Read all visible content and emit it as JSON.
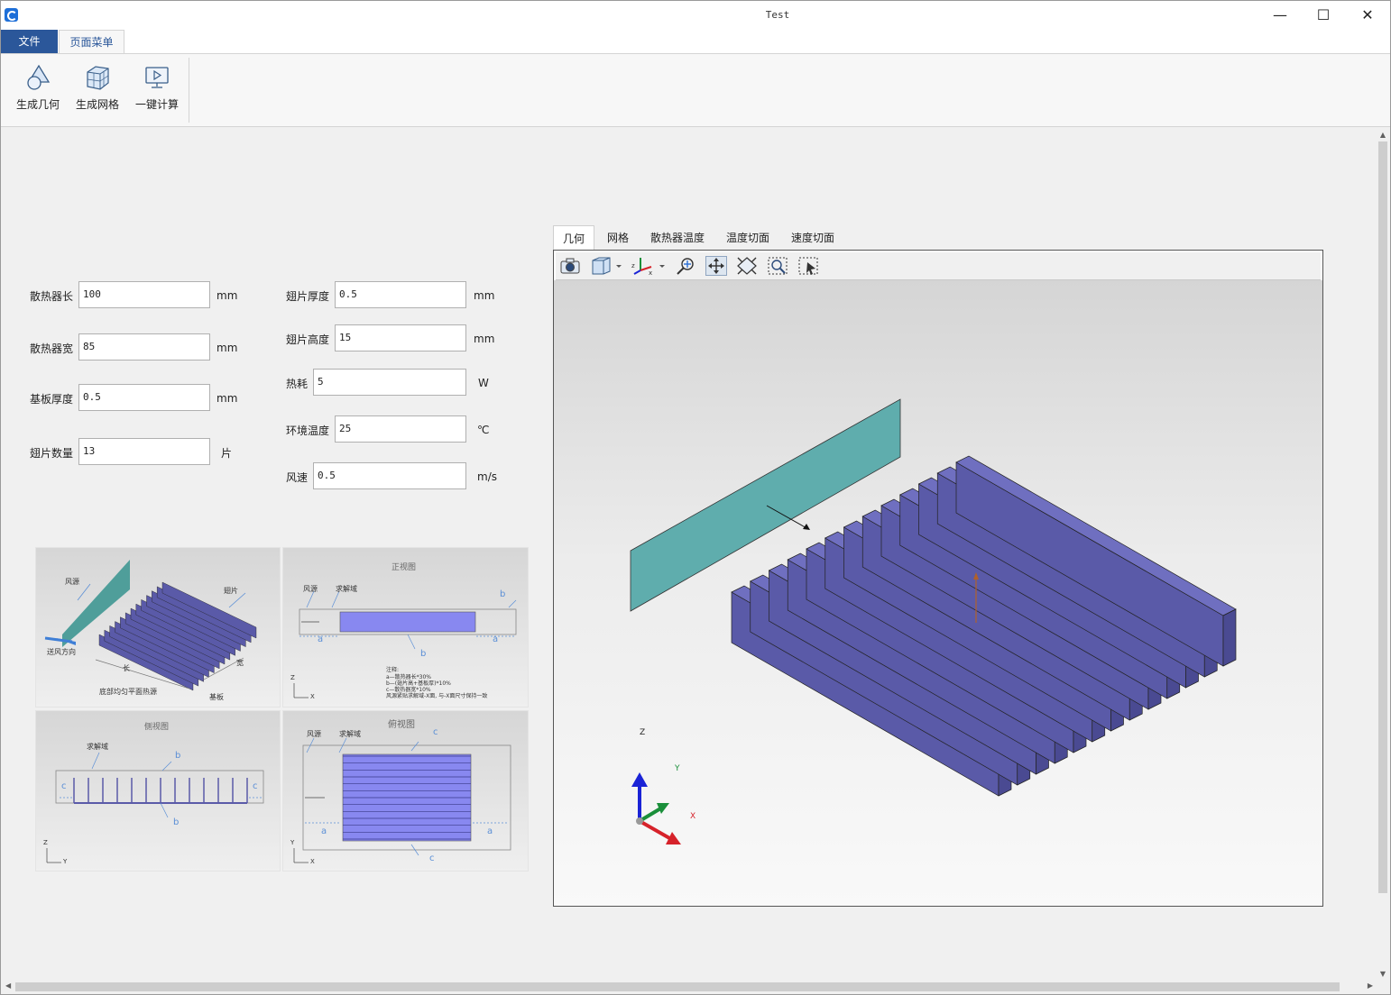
{
  "window": {
    "title": "Test"
  },
  "ribbon": {
    "tabs": [
      "文件",
      "页面菜单"
    ],
    "buttons": [
      {
        "label": "生成几何",
        "icon": "geometry-shapes-icon"
      },
      {
        "label": "生成网格",
        "icon": "mesh-cube-icon"
      },
      {
        "label": "一键计算",
        "icon": "compute-monitor-icon"
      }
    ]
  },
  "params": {
    "left": [
      {
        "label": "散热器长",
        "value": "100",
        "unit": "mm"
      },
      {
        "label": "散热器宽",
        "value": "85",
        "unit": "mm"
      },
      {
        "label": "基板厚度",
        "value": "0.5",
        "unit": "mm"
      },
      {
        "label": "翅片数量",
        "value": "13",
        "unit": "片"
      }
    ],
    "right": [
      {
        "label": "翅片厚度",
        "value": "0.5",
        "unit": "mm"
      },
      {
        "label": "翅片高度",
        "value": "15",
        "unit": "mm"
      },
      {
        "label": "热耗",
        "value": "5",
        "unit": "W"
      },
      {
        "label": "环境温度",
        "value": "25",
        "unit": "℃"
      },
      {
        "label": "风速",
        "value": "0.5",
        "unit": "m/s"
      }
    ]
  },
  "diagrams": {
    "iso": {
      "fan": "风源",
      "fin": "翅片",
      "air_dir": "送风方向",
      "length": "长",
      "width": "宽",
      "heat": "底部均匀平面热源",
      "base": "基板"
    },
    "front": {
      "title": "正视图",
      "fan": "风源",
      "domain": "求解域",
      "a": "a",
      "b": "b",
      "notes": [
        "注释:",
        "a—散热器长*30%",
        "b—(翅片高+基板厚)*10%",
        "c—散热器宽*10%",
        "风源紧贴求解域-X面, 与-X面尺寸保持一致"
      ],
      "ax1": "Z",
      "ax2": "X"
    },
    "side": {
      "title": "侧视图",
      "domain": "求解域",
      "b": "b",
      "c": "c",
      "ax1": "Z",
      "ax2": "Y"
    },
    "top": {
      "title": "俯视图",
      "fan": "风源",
      "domain": "求解域",
      "a": "a",
      "c": "c",
      "ax1": "Y",
      "ax2": "X"
    }
  },
  "viewer": {
    "tabs": [
      "几何",
      "网格",
      "散热器温度",
      "温度切面",
      "速度切面"
    ],
    "active_tab": "几何",
    "toolbar": [
      "camera-icon",
      "view-cube-icon",
      "axes-icon",
      "zoom-fit-icon",
      "pan-icon",
      "fit-all-icon",
      "zoom-window-icon",
      "select-box-icon"
    ],
    "triad": {
      "z": "Z",
      "y": "Y",
      "x": "X"
    },
    "colors": {
      "fins": "#5a5aa8",
      "fin_top": "#6f6fc0",
      "inlet": "#5fadad",
      "z_axis": "#1a23d6",
      "y_axis": "#1a8f3a",
      "x_axis": "#d6222a"
    }
  }
}
